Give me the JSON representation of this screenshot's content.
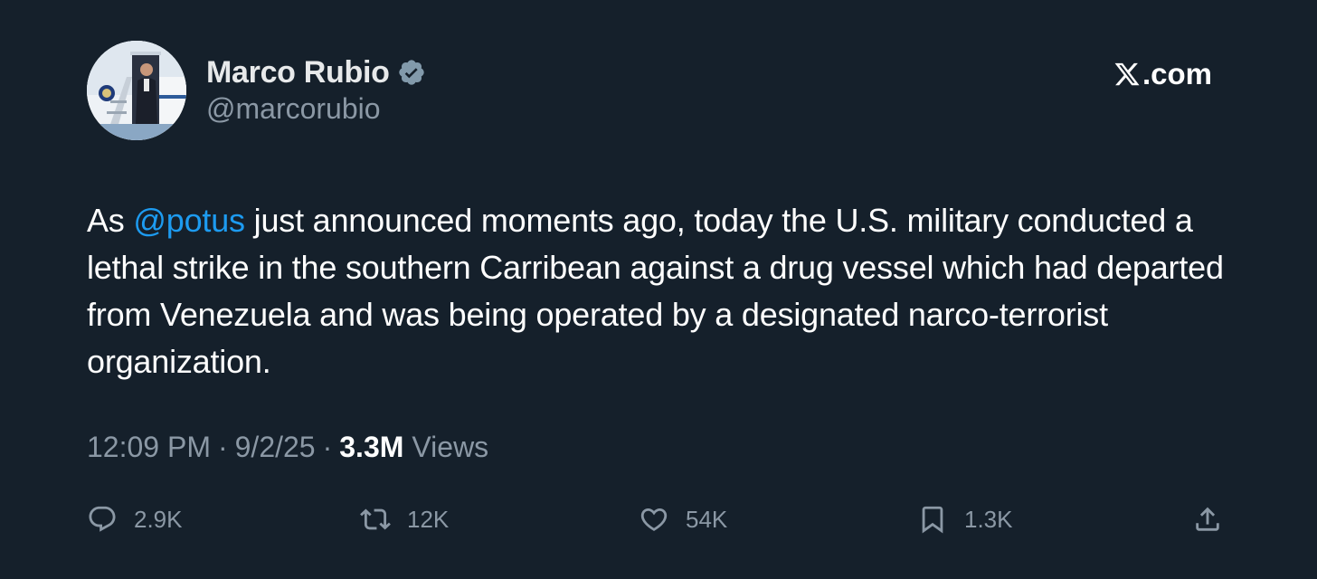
{
  "author": {
    "display_name": "Marco Rubio",
    "handle": "@marcorubio",
    "verified": true
  },
  "brand": {
    "site": ".com"
  },
  "tweet": {
    "text_before_mention": "As ",
    "mention": "@potus",
    "text_after_mention": " just announced moments ago, today the U.S. military conducted a lethal strike in the southern Carribean against a drug vessel which had departed from Venezuela and was being operated by a designated narco-terrorist organization."
  },
  "meta": {
    "time": "12:09 PM",
    "separator": "·",
    "date": "9/2/25",
    "views_count": "3.3M",
    "views_label": "Views"
  },
  "actions": {
    "replies": "2.9K",
    "reposts": "12K",
    "likes": "54K",
    "bookmarks": "1.3K"
  },
  "colors": {
    "background": "#15202b",
    "text_primary": "#e7e9ea",
    "text_secondary": "#8b98a5",
    "mention": "#1d9bf0"
  },
  "icons": {
    "verified": "verified-badge-icon",
    "brand": "x-logo-icon",
    "reply": "reply-icon",
    "repost": "repost-icon",
    "like": "heart-icon",
    "bookmark": "bookmark-icon",
    "share": "share-icon"
  }
}
